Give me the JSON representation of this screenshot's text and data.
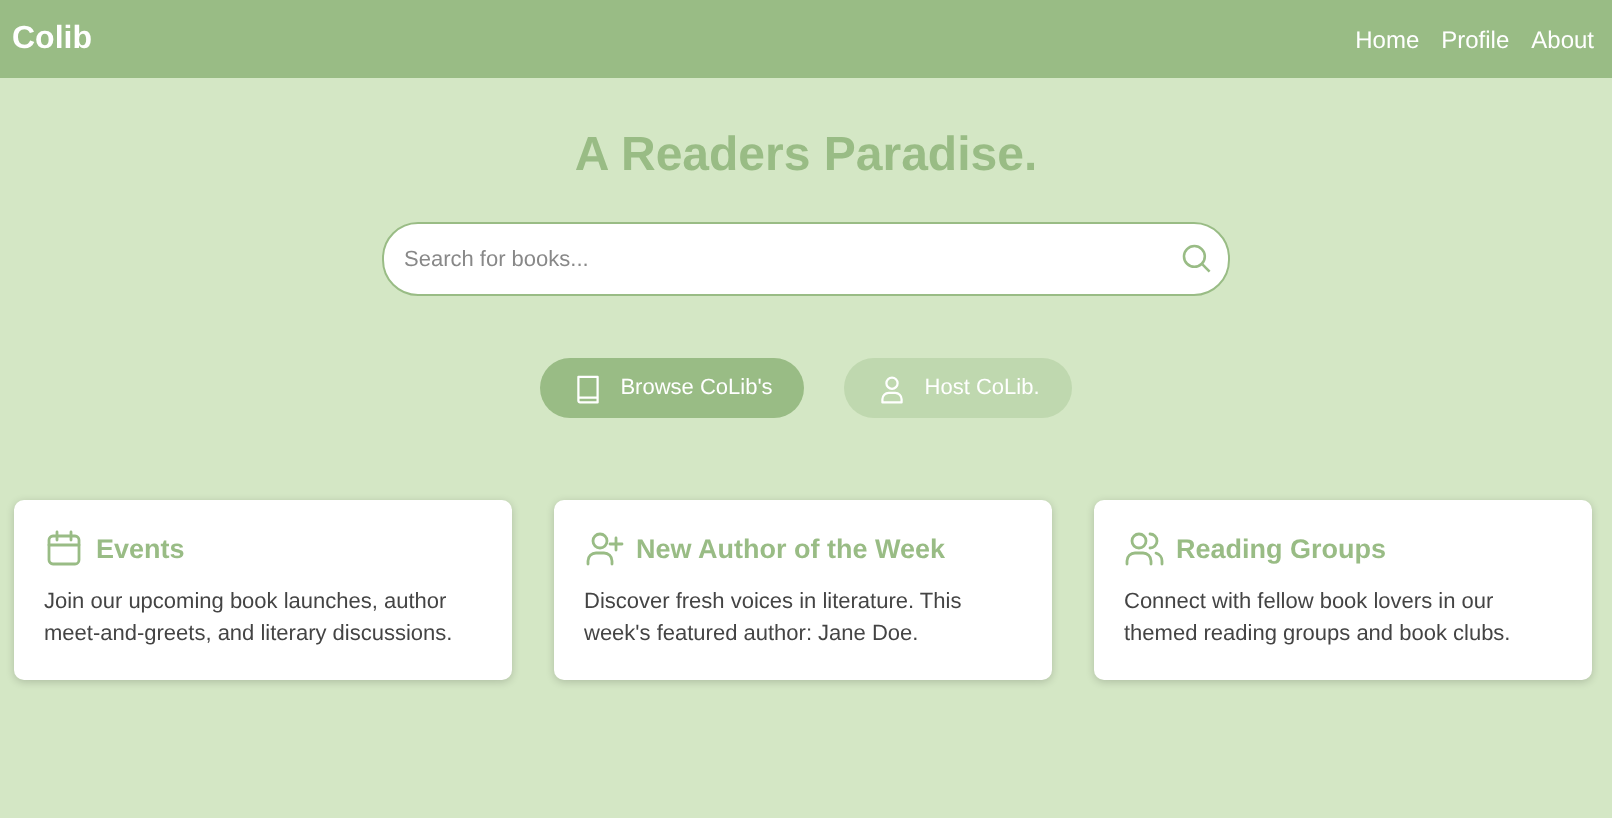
{
  "header": {
    "logo": "Colib",
    "nav": [
      {
        "label": "Home"
      },
      {
        "label": "Profile"
      },
      {
        "label": "About"
      }
    ]
  },
  "hero": {
    "title": "A Readers Paradise.",
    "search": {
      "placeholder": "Search for books..."
    }
  },
  "actions": [
    {
      "label": "Browse CoLib's",
      "kind": "primary"
    },
    {
      "label": "Host CoLib.",
      "kind": "secondary"
    }
  ],
  "cards": [
    {
      "title": "Events",
      "text": "Join our upcoming book launches, author meet-and-greets, and literary discussions."
    },
    {
      "title": "New Author of the Week",
      "text": "Discover fresh voices in literature. This week's featured author: Jane Doe."
    },
    {
      "title": "Reading Groups",
      "text": "Connect with fellow book lovers in our themed reading groups and book clubs."
    }
  ]
}
